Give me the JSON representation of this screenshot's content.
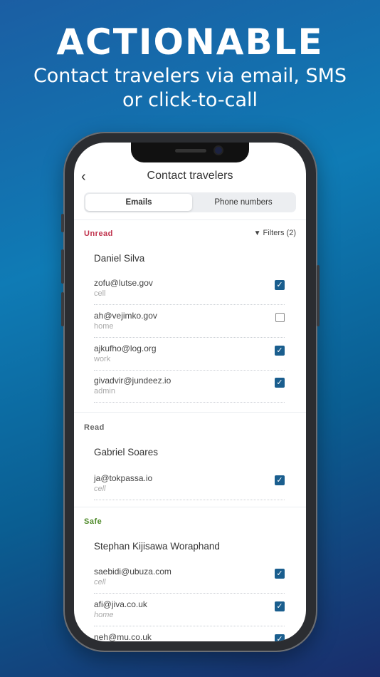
{
  "promo": {
    "headline": "ACTIONABLE",
    "subline_1": "Contact travelers via email, SMS",
    "subline_2": "or click-to-call"
  },
  "nav": {
    "back_icon": "chevron-left-icon",
    "title": "Contact travelers"
  },
  "tabs": [
    {
      "label": "Emails",
      "selected": true
    },
    {
      "label": "Phone numbers",
      "selected": false
    }
  ],
  "filters_label": "Filters (2)",
  "colors": {
    "unread": "#c0334d",
    "read": "#666666",
    "safe": "#4f8a2a",
    "checkbox": "#1a5e8e"
  },
  "sections": [
    {
      "label": "Unread",
      "person": "Daniel Silva",
      "contacts": [
        {
          "email": "zofu@lutse.gov",
          "type": "cell",
          "checked": true
        },
        {
          "email": "ah@vejimko.gov",
          "type": "home",
          "checked": false
        },
        {
          "email": "ajkufho@log.org",
          "type": "work",
          "checked": true
        },
        {
          "email": "givadvir@jundeez.io",
          "type": "admin",
          "checked": true
        }
      ]
    },
    {
      "label": "Read",
      "person": "Gabriel Soares",
      "contacts": [
        {
          "email": "ja@tokpassa.io",
          "type": "cell",
          "checked": true
        }
      ]
    },
    {
      "label": "Safe",
      "person": "Stephan Kijisawa Woraphand",
      "contacts": [
        {
          "email": "saebidi@ubuza.com",
          "type": "cell",
          "checked": true
        },
        {
          "email": "afi@jiva.co.uk",
          "type": "home",
          "checked": true
        },
        {
          "email": "neh@mu.co.uk",
          "type": "",
          "checked": true
        }
      ]
    }
  ]
}
